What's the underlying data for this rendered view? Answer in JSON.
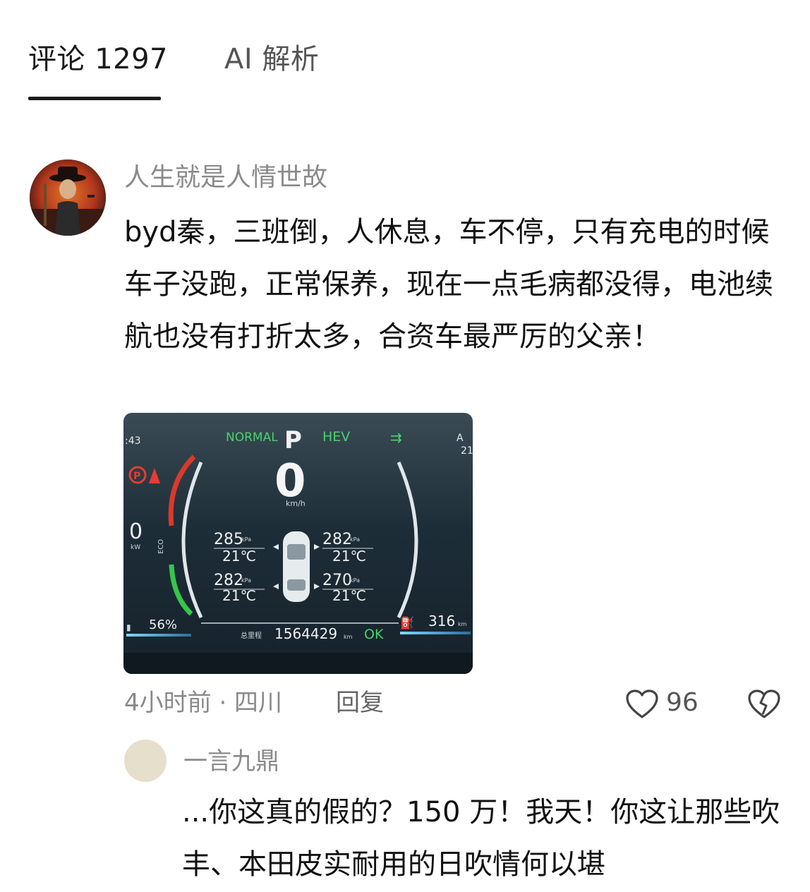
{
  "tabs": {
    "comments_label": "评论 1297",
    "ai_label": "AI 解析"
  },
  "comment": {
    "username": "人生就是人情世故",
    "text": "byd秦，三班倒，人休息，车不停，只有充电的时候车子没跑，正常保养，现在一点毛病都没得，电池续航也没有打折太多，合资车最严厉的父亲！",
    "image": {
      "time": ":43",
      "mode": "NORMAL",
      "gear": "P",
      "hev": "HEV",
      "top_right": "A",
      "top_right_sub": "21",
      "speed": "0",
      "speed_unit": "km/h",
      "power": "0",
      "power_unit": "kW",
      "eco_label": "ECO",
      "tires": [
        {
          "pressure": "285",
          "unit": "kPa",
          "temp": "21℃"
        },
        {
          "pressure": "282",
          "unit": "kPa",
          "temp": "21℃"
        },
        {
          "pressure": "282",
          "unit": "kPa",
          "temp": "21℃"
        },
        {
          "pressure": "270",
          "unit": "kPa",
          "temp": "21℃"
        }
      ],
      "battery": "56%",
      "odometer_label": "总里程",
      "odometer": "1564429",
      "odometer_unit": "km",
      "status": "OK",
      "range": "316",
      "range_unit": "km"
    },
    "meta": "4小时前 · 四川",
    "reply_label": "回复",
    "likes": "96"
  },
  "reply": {
    "username": "一言九鼎",
    "text": "...你这真的假的？150 万！我天！你这让那些吹丰、本田皮实耐用的日吹情何以堪"
  },
  "colors": {
    "text": "#111111",
    "muted": "#8a8a8a",
    "dash_bg": "#1f2e3a",
    "dash_accent_green": "#39d353",
    "dash_accent_blue": "#4fc3f7"
  }
}
